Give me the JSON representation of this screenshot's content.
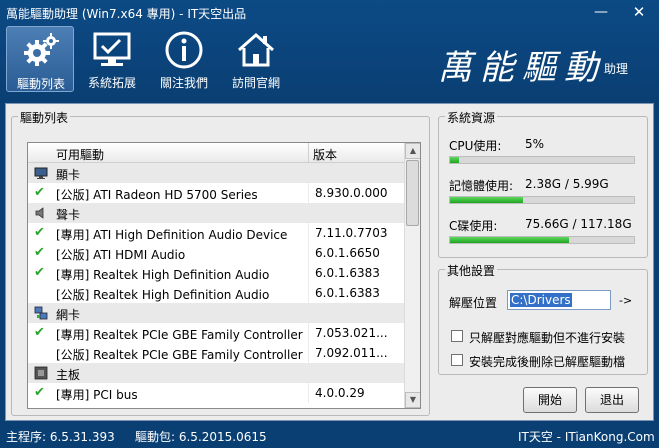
{
  "window": {
    "title": "萬能驅動助理 (Win7.x64 專用) - IT天空出品",
    "minimize": "—",
    "close": "✕"
  },
  "toolbar": {
    "items": [
      {
        "label": "驅動列表",
        "icon": "gear-icon",
        "active": true
      },
      {
        "label": "系統拓展",
        "icon": "monitor-check-icon",
        "active": false
      },
      {
        "label": "關注我們",
        "icon": "info-icon",
        "active": false
      },
      {
        "label": "訪問官網",
        "icon": "home-icon",
        "active": false
      }
    ],
    "logo_text": "萬能驅動",
    "logo_sub": "助理"
  },
  "driver_list": {
    "legend": "驅動列表",
    "col_driver": "可用驅動",
    "col_version": "版本",
    "rows": [
      {
        "type": "category",
        "name": "顯卡",
        "icon": "display-icon"
      },
      {
        "type": "driver",
        "name": "[公版] ATI Radeon HD 5700 Series",
        "version": "8.930.0.000",
        "checked": true
      },
      {
        "type": "category",
        "name": "聲卡",
        "icon": "speaker-icon"
      },
      {
        "type": "driver",
        "name": "[專用] ATI High Definition Audio Device",
        "version": "7.11.0.7703",
        "checked": true
      },
      {
        "type": "driver",
        "name": "[公版] ATI HDMI Audio",
        "version": "6.0.1.6650",
        "checked": true
      },
      {
        "type": "driver",
        "name": "[專用] Realtek High Definition Audio",
        "version": "6.0.1.6383",
        "checked": true
      },
      {
        "type": "driver",
        "name": "[公版] Realtek High Definition Audio",
        "version": "6.0.1.6383",
        "checked": false
      },
      {
        "type": "category",
        "name": "網卡",
        "icon": "network-icon"
      },
      {
        "type": "driver",
        "name": "[專用] Realtek PCIe GBE Family Controller",
        "version": "7.053.021...",
        "checked": true
      },
      {
        "type": "driver",
        "name": "[公版] Realtek PCIe GBE Family Controller",
        "version": "7.092.011...",
        "checked": false
      },
      {
        "type": "category",
        "name": "主板",
        "icon": "motherboard-icon"
      },
      {
        "type": "driver",
        "name": "[專用] PCI bus",
        "version": "4.0.0.29",
        "checked": true
      }
    ]
  },
  "resources": {
    "legend": "系統資源",
    "cpu_label": "CPU使用:",
    "cpu_value": "5%",
    "cpu_fraction": 0.05,
    "mem_label": "記憶體使用:",
    "mem_value": "2.38G / 5.99G",
    "mem_fraction": 0.397,
    "disk_label": "C碟使用:",
    "disk_value": "75.66G / 117.18G",
    "disk_fraction": 0.646
  },
  "settings": {
    "legend": "其他設置",
    "path_label": "解壓位置",
    "path_value": "C:\\Drivers",
    "browse": "->",
    "opt1": "只解壓對應驅動但不進行安裝",
    "opt2": "安裝完成後刪除已解壓驅動檔"
  },
  "buttons": {
    "start": "開始",
    "exit": "退出"
  },
  "status": {
    "main_prog": "主程序: 6.5.31.393",
    "drv_pack": "驅動包: 6.5.2015.0615",
    "site": "IT天空 - ITianKong.Com"
  }
}
